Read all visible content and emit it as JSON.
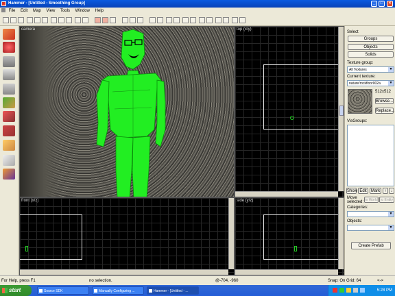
{
  "window": {
    "title": "Hammer - [Untitled - Smoothing Group]",
    "min_label": "_",
    "max_label": "□",
    "close_label": "×"
  },
  "menu": [
    "File",
    "Edit",
    "Map",
    "View",
    "Tools",
    "Window",
    "Help"
  ],
  "viewports": {
    "camera": {
      "label": "camera"
    },
    "top": {
      "label": "top (x/y)"
    },
    "front": {
      "label": "front (x/z)"
    },
    "side": {
      "label": "side (y/z)"
    }
  },
  "panel": {
    "select_label": "Select",
    "groups_btn": "Groups",
    "objects_btn": "Objects",
    "solids_btn": "Solids",
    "texture_group_label": "Texture group:",
    "texture_group_value": "All Textures",
    "current_texture_label": "Current texture:",
    "current_texture_value": "nature/rockfloor002a",
    "texture_size": "512x512",
    "browse_btn": "Browse...",
    "replace_btn": "Replace...",
    "visgroups_label": "VisGroups:",
    "show_btn": "Show",
    "edit_btn": "Edit",
    "mark_btn": "Mark",
    "move_selected_label": "Move selected:",
    "to_world_btn": "to World",
    "to_entity_btn": "to Entity",
    "categories_label": "Categories:",
    "objects_label": "Objects:",
    "create_prefab_btn": "Create Prefab"
  },
  "status": {
    "help": "For Help, press F1",
    "selection": "no selection.",
    "coords": "@-704, -960",
    "snap": "Snap: On Grid: 64",
    "extra": "<->"
  },
  "taskbar": {
    "start": "start",
    "tasks": [
      "Source SDK",
      "Manually Configuring ...",
      "Hammer - [Untitled - ..."
    ],
    "clock": "5:28 PM"
  },
  "colors": {
    "figure": "#22ee22",
    "grid": "#2b2b2b",
    "grid_major": "#444444",
    "brush": "#e8e8e8",
    "xp_blue": "#245dd7"
  }
}
